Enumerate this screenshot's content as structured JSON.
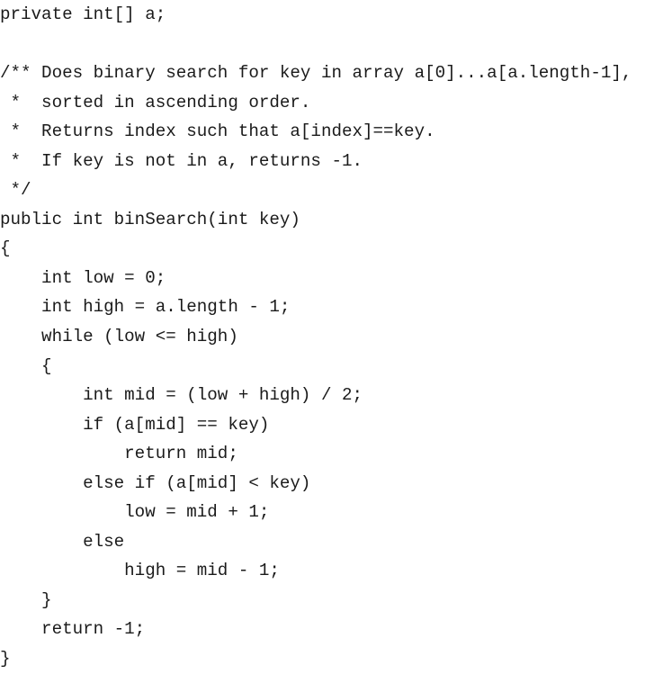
{
  "document": {
    "language": "Java",
    "lines": [
      "private int[] a;",
      "",
      "/** Does binary search for key in array a[0]...a[a.length-1],",
      " *  sorted in ascending order.",
      " *  Returns index such that a[index]==key.",
      " *  If key is not in a, returns -1.",
      " */",
      "public int binSearch(int key)",
      "{",
      "    int low = 0;",
      "    int high = a.length - 1;",
      "    while (low <= high)",
      "    {",
      "        int mid = (low + high) / 2;",
      "        if (a[mid] == key)",
      "            return mid;",
      "        else if (a[mid] < key)",
      "            low = mid + 1;",
      "        else",
      "            high = mid - 1;",
      "    }",
      "    return -1;",
      "}"
    ]
  }
}
